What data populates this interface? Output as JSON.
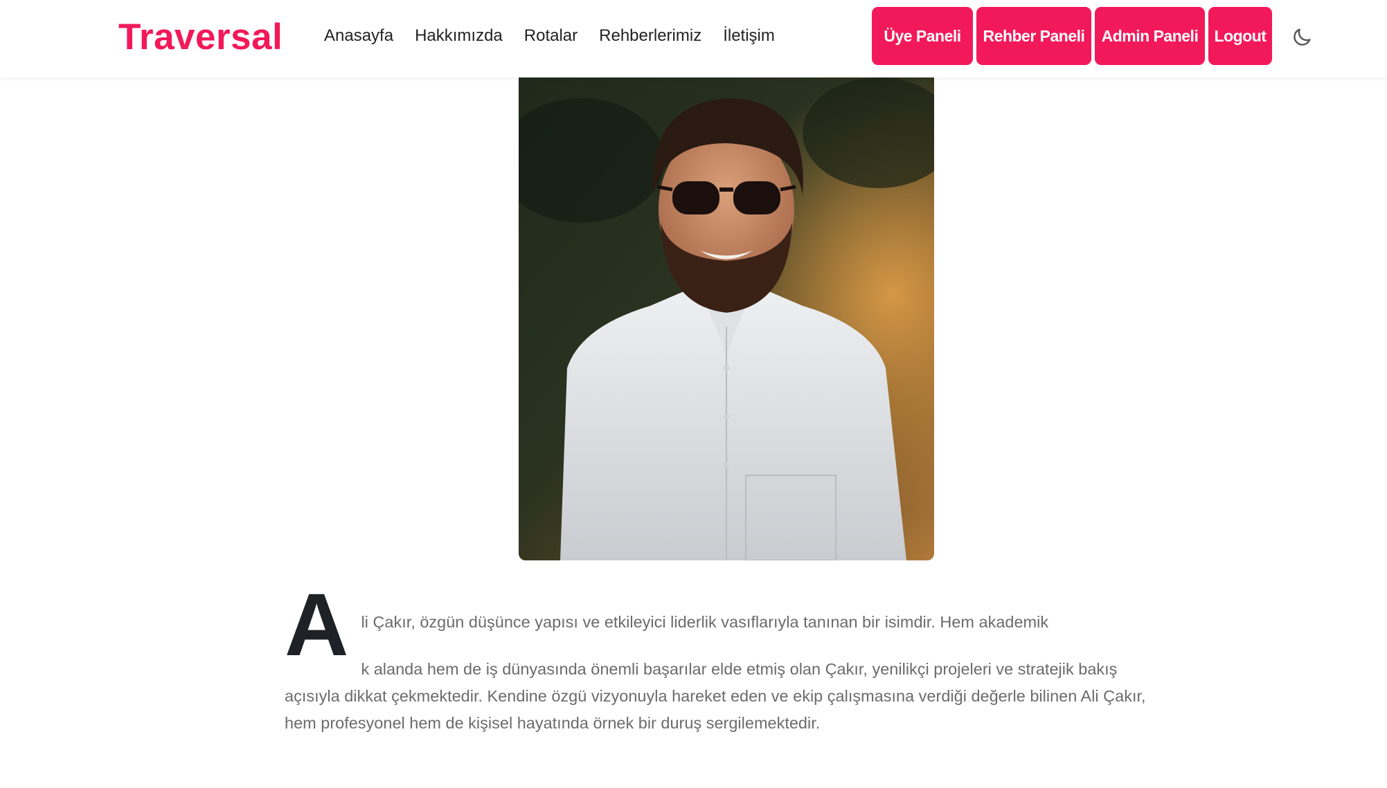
{
  "brand": "Traversal",
  "nav": {
    "links": [
      "Anasayfa",
      "Hakkımızda",
      "Rotalar",
      "Rehberlerimiz",
      "İletişim"
    ],
    "buttons": {
      "member_panel": "Üye Paneli",
      "guide_panel": "Rehber Paneli",
      "admin_panel": "Admin Paneli",
      "logout": "Logout"
    },
    "theme_icon": "moon-icon"
  },
  "profile": {
    "photo_alt": "Ali Çakır",
    "drop_cap": "A",
    "first_line": "li Çakır, özgün düşünce yapısı ve etkileyici liderlik vasıflarıyla tanınan bir isimdir. Hem akademik",
    "rest": "k alanda hem de iş dünyasında önemli başarılar elde etmiş olan Çakır, yenilikçi projeleri ve stratejik bakış açısıyla dikkat çekmektedir. Kendine özgü vizyonuyla hareket eden ve ekip çalışmasına verdiği değerle bilinen Ali Çakır, hem profesyonel hem de kişisel hayatında örnek bir duruş sergilemektedir."
  },
  "colors": {
    "accent": "#f2195a",
    "text": "#6b6b6b",
    "heading": "#1e2125"
  }
}
